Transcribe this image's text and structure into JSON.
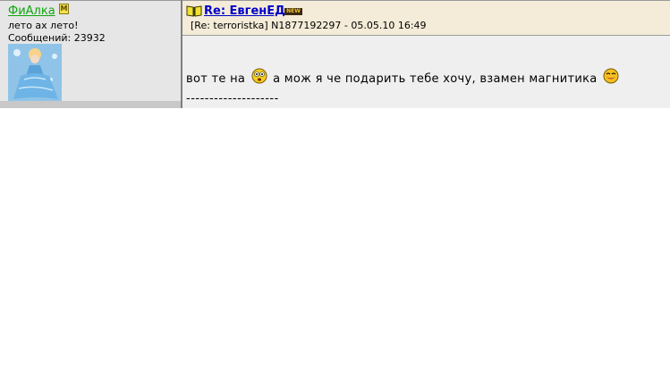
{
  "author": {
    "username": "ФиАлка",
    "mod_badge": "M",
    "status": "лето ах лето!",
    "message_count": "Сообщений: 23932"
  },
  "post": {
    "subject": "Re: ЕвгенЕД",
    "new_badge": "NEW",
    "meta": "[Re: terroristka]  N1877192297 - 05.05.10 16:49",
    "text_part1": "вот те на",
    "text_part2": "а мож я че подарить тебе хочу, взамен магнитика",
    "signature_separator": "--------------------"
  },
  "icons": [
    "book-icon",
    "surprised-smiley-icon",
    "tongue-smiley-icon",
    "avatar-image"
  ],
  "colors": {
    "username": "#11a611",
    "subject_link": "#0000c8",
    "header_bg": "#f4ecd8",
    "sidebar_bg": "#e6e6e6",
    "body_bg": "#efefef"
  }
}
